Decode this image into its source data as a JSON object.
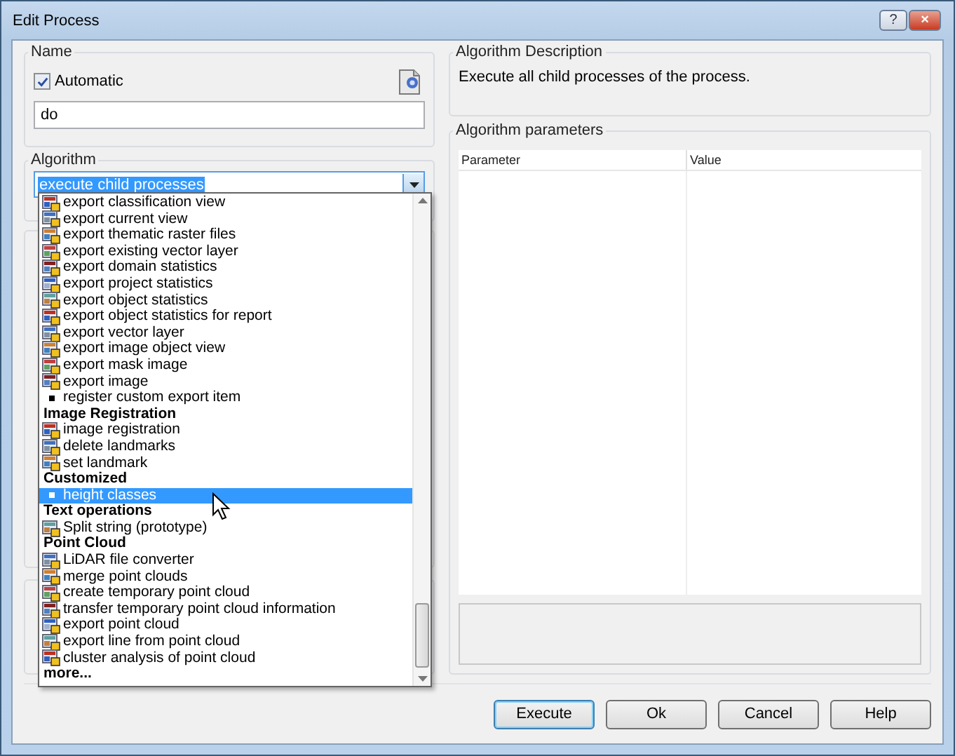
{
  "window": {
    "title": "Edit Process",
    "help_button": "?",
    "close_button": "×"
  },
  "name_group": {
    "label": "Name",
    "automatic": {
      "label": "Automatic",
      "checked": true
    },
    "value": "do"
  },
  "algorithm_group": {
    "label": "Algorithm",
    "value": "execute child processes"
  },
  "dropdown": {
    "items": [
      {
        "kind": "item",
        "label": "export classification view",
        "selected": false
      },
      {
        "kind": "item",
        "label": "export current view",
        "selected": false
      },
      {
        "kind": "item",
        "label": "export thematic raster files",
        "selected": false
      },
      {
        "kind": "item",
        "label": "export existing vector layer",
        "selected": false
      },
      {
        "kind": "item",
        "label": "export domain statistics",
        "selected": false
      },
      {
        "kind": "item",
        "label": "export project statistics",
        "selected": false
      },
      {
        "kind": "item",
        "label": "export object statistics",
        "selected": false
      },
      {
        "kind": "item",
        "label": "export object statistics for report",
        "selected": false
      },
      {
        "kind": "item",
        "label": "export vector layer",
        "selected": false
      },
      {
        "kind": "item",
        "label": "export image object view",
        "selected": false
      },
      {
        "kind": "item",
        "label": "export mask image",
        "selected": false
      },
      {
        "kind": "item",
        "label": "export image",
        "selected": false
      },
      {
        "kind": "bullet",
        "label": "register custom export item",
        "selected": false
      },
      {
        "kind": "header",
        "label": "Image Registration",
        "selected": false
      },
      {
        "kind": "item",
        "label": "image registration",
        "selected": false
      },
      {
        "kind": "item",
        "label": "delete landmarks",
        "selected": false
      },
      {
        "kind": "item",
        "label": "set landmark",
        "selected": false
      },
      {
        "kind": "header",
        "label": "Customized",
        "selected": false
      },
      {
        "kind": "bullet",
        "label": "height classes",
        "selected": true
      },
      {
        "kind": "header",
        "label": "Text operations",
        "selected": false
      },
      {
        "kind": "item",
        "label": "Split string (prototype)",
        "selected": false
      },
      {
        "kind": "header",
        "label": "Point Cloud",
        "selected": false
      },
      {
        "kind": "item",
        "label": "LiDAR file converter",
        "selected": false
      },
      {
        "kind": "item",
        "label": "merge point clouds",
        "selected": false
      },
      {
        "kind": "item",
        "label": "create temporary point cloud",
        "selected": false
      },
      {
        "kind": "item",
        "label": "transfer temporary point cloud information",
        "selected": false
      },
      {
        "kind": "item",
        "label": "export point cloud",
        "selected": false
      },
      {
        "kind": "item",
        "label": "export line from point cloud",
        "selected": false
      },
      {
        "kind": "item",
        "label": "cluster analysis of point cloud",
        "selected": false
      },
      {
        "kind": "header",
        "label": "more...",
        "selected": false
      }
    ]
  },
  "description": {
    "label": "Algorithm Description",
    "text": "Execute all child processes of the process."
  },
  "parameters": {
    "label": "Algorithm parameters",
    "columns": [
      "Parameter",
      "Value"
    ]
  },
  "buttons": [
    {
      "label": "Execute",
      "default": true
    },
    {
      "label": "Ok",
      "default": false
    },
    {
      "label": "Cancel",
      "default": false
    },
    {
      "label": "Help",
      "default": false
    }
  ]
}
